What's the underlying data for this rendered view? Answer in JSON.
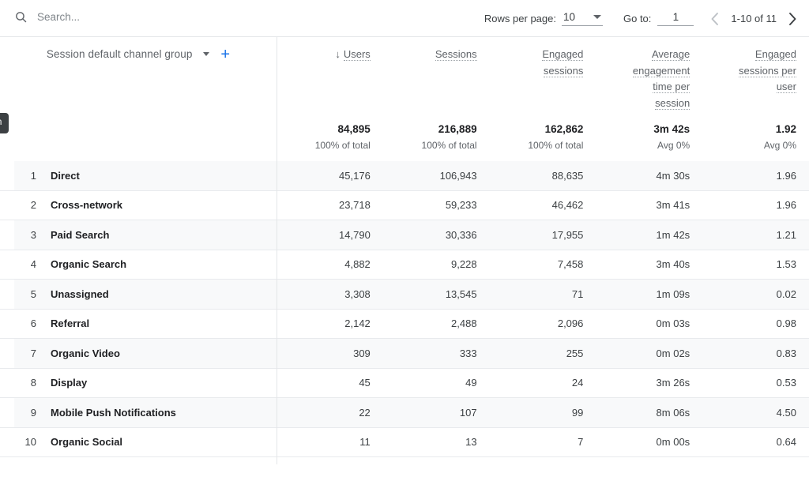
{
  "toolbar": {
    "search_placeholder": "Search...",
    "search_value": "",
    "search_icon": "search-icon",
    "rows_per_page_label": "Rows per page:",
    "rows_per_page_value": "10",
    "goto_label": "Go to:",
    "goto_value": "1",
    "range_text": "1-10 of 11",
    "prev_icon": "chevron-left-icon",
    "next_icon": "chevron-right-icon"
  },
  "tooltip_fragment": {
    "text": "ion"
  },
  "dimension": {
    "title": "Session default channel group",
    "caret_icon": "chevron-down-icon",
    "add_icon": "plus-icon"
  },
  "colors": {
    "accent_blue": "#1a73e8",
    "row_stripe": "#f8f9fa",
    "border": "#e4e6e8",
    "text_primary": "#202124",
    "text_secondary": "#5f6368"
  },
  "chart_data": {
    "type": "table",
    "title": "Session default channel group",
    "dimension_column": "Session default channel group",
    "columns": [
      "Users",
      "Sessions",
      "Engaged sessions",
      "Average engagement time per session",
      "Engaged sessions per user"
    ],
    "sorted_by": "Users",
    "sort_direction": "desc",
    "sort_arrow": "↓",
    "totals": [
      {
        "value": "84,895",
        "sub": "100% of total"
      },
      {
        "value": "216,889",
        "sub": "100% of total"
      },
      {
        "value": "162,862",
        "sub": "100% of total"
      },
      {
        "value": "3m 42s",
        "sub": "Avg 0%"
      },
      {
        "value": "1.92",
        "sub": "Avg 0%"
      }
    ],
    "rows": [
      {
        "index": "1",
        "name": "Direct",
        "values": [
          "45,176",
          "106,943",
          "88,635",
          "4m 30s",
          "1.96"
        ]
      },
      {
        "index": "2",
        "name": "Cross-network",
        "values": [
          "23,718",
          "59,233",
          "46,462",
          "3m 41s",
          "1.96"
        ]
      },
      {
        "index": "3",
        "name": "Paid Search",
        "values": [
          "14,790",
          "30,336",
          "17,955",
          "1m 42s",
          "1.21"
        ]
      },
      {
        "index": "4",
        "name": "Organic Search",
        "values": [
          "4,882",
          "9,228",
          "7,458",
          "3m 40s",
          "1.53"
        ]
      },
      {
        "index": "5",
        "name": "Unassigned",
        "values": [
          "3,308",
          "13,545",
          "71",
          "1m 09s",
          "0.02"
        ]
      },
      {
        "index": "6",
        "name": "Referral",
        "values": [
          "2,142",
          "2,488",
          "2,096",
          "0m 03s",
          "0.98"
        ]
      },
      {
        "index": "7",
        "name": "Organic Video",
        "values": [
          "309",
          "333",
          "255",
          "0m 02s",
          "0.83"
        ]
      },
      {
        "index": "8",
        "name": "Display",
        "values": [
          "45",
          "49",
          "24",
          "3m 26s",
          "0.53"
        ]
      },
      {
        "index": "9",
        "name": "Mobile Push Notifications",
        "values": [
          "22",
          "107",
          "99",
          "8m 06s",
          "4.50"
        ]
      },
      {
        "index": "10",
        "name": "Organic Social",
        "values": [
          "11",
          "13",
          "7",
          "0m 00s",
          "0.64"
        ]
      }
    ]
  }
}
